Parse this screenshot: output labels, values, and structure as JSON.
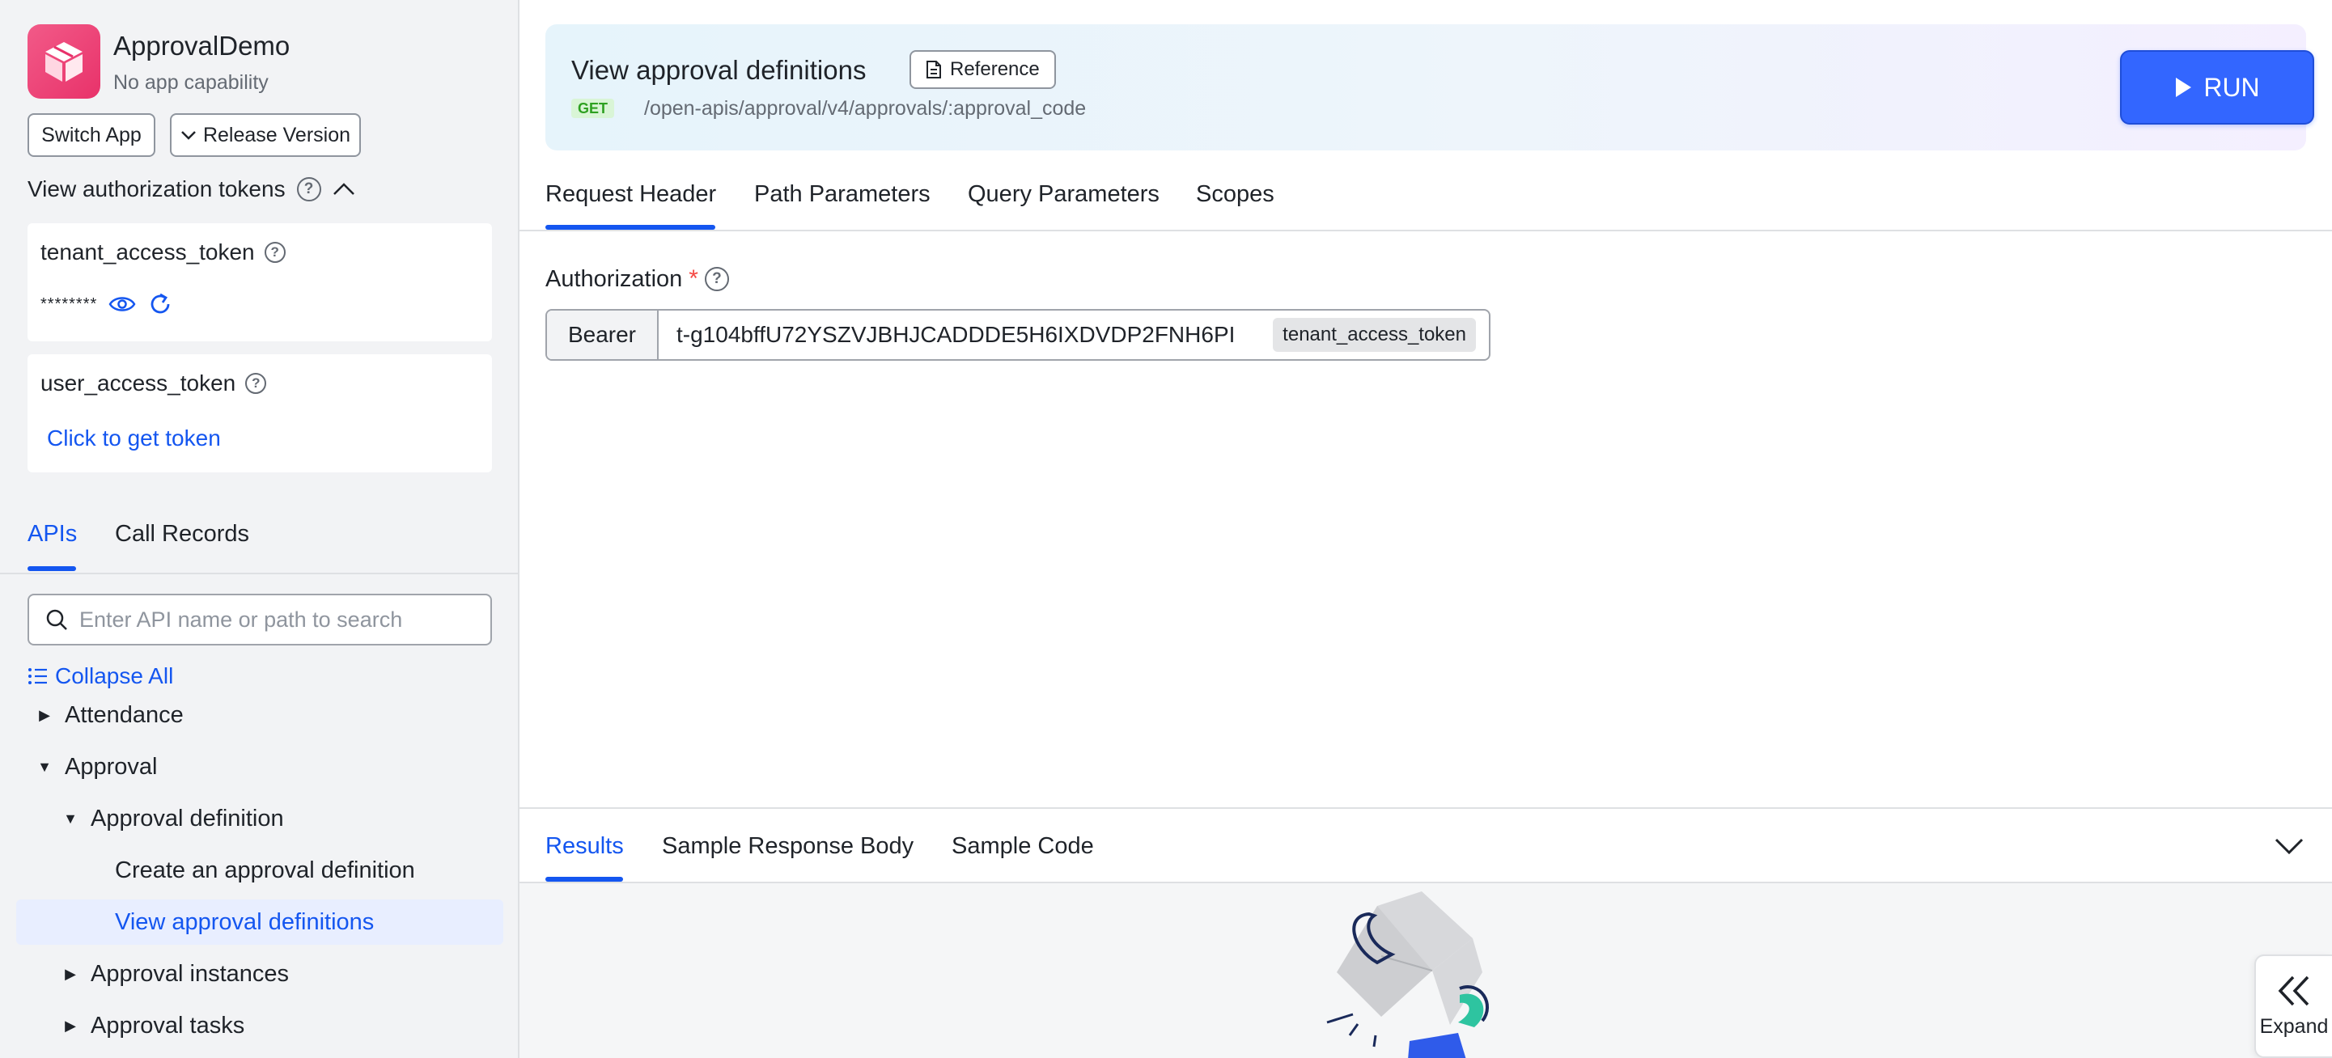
{
  "app": {
    "name": "ApprovalDemo",
    "subtitle": "No app capability",
    "switch_app": "Switch App",
    "release_version": "Release Version"
  },
  "tokens": {
    "title": "View authorization tokens",
    "tenant": {
      "label": "tenant_access_token",
      "masked": "********"
    },
    "user": {
      "label": "user_access_token",
      "action": "Click to get token"
    }
  },
  "sidebar_tabs": [
    {
      "label": "APIs",
      "active": true
    },
    {
      "label": "Call Records",
      "active": false
    }
  ],
  "search": {
    "placeholder": "Enter API name or path to search"
  },
  "collapse_all": "Collapse All",
  "tree": [
    {
      "label": "Attendance",
      "level": 0,
      "expanded": false
    },
    {
      "label": "Approval",
      "level": 0,
      "expanded": true
    },
    {
      "label": "Approval definition",
      "level": 1,
      "expanded": true
    },
    {
      "label": "Create an approval definition",
      "level": 2
    },
    {
      "label": "View approval definitions",
      "level": 2,
      "selected": true
    },
    {
      "label": "Approval instances",
      "level": 1,
      "expanded": false
    },
    {
      "label": "Approval tasks",
      "level": 1,
      "expanded": false
    }
  ],
  "api": {
    "title": "View approval definitions",
    "reference": "Reference",
    "method": "GET",
    "path": "/open-apis/approval/v4/approvals/:approval_code",
    "run": "RUN"
  },
  "main_tabs": [
    {
      "label": "Request Header",
      "active": true
    },
    {
      "label": "Path Parameters",
      "active": false
    },
    {
      "label": "Query Parameters",
      "active": false
    },
    {
      "label": "Scopes",
      "active": false
    }
  ],
  "authorization": {
    "label": "Authorization",
    "required_mark": "*",
    "prefix": "Bearer",
    "value": "t-g104bffU72YSZVJBHJCADDDE5H6IXDVDP2FNH6PI",
    "token_type": "tenant_access_token"
  },
  "result_tabs": [
    {
      "label": "Results",
      "active": true
    },
    {
      "label": "Sample Response Body",
      "active": false
    },
    {
      "label": "Sample Code",
      "active": false
    }
  ],
  "expand": "Expand",
  "colors": {
    "accent": "#1456f0",
    "run_button": "#3366ff",
    "app_logo": "#e8326a",
    "get_badge_bg": "#d9f5d6",
    "get_badge_text": "#2ea121",
    "required": "#f54a45"
  }
}
